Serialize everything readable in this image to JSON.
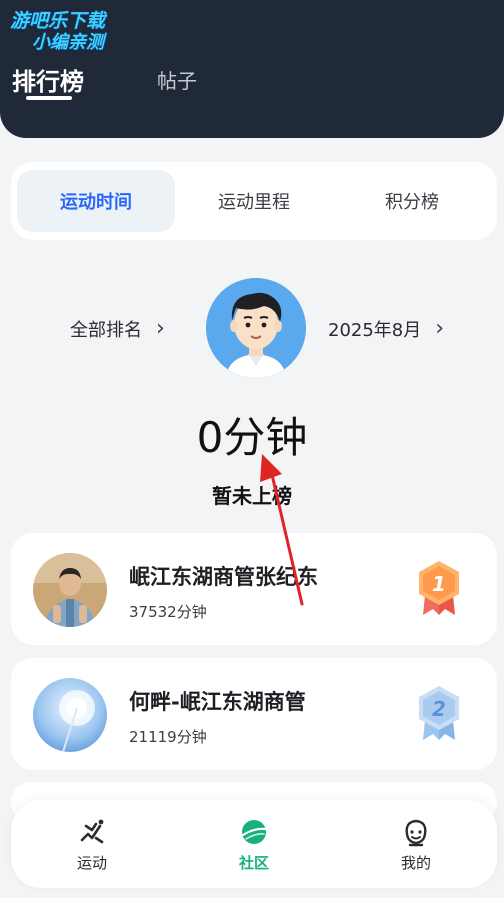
{
  "watermark": {
    "line1": "游吧乐下载",
    "line2": "小编亲测"
  },
  "header": {
    "tabs": [
      {
        "label": "排行榜",
        "active": true
      },
      {
        "label": "帖子",
        "active": false
      }
    ]
  },
  "segments": [
    {
      "label": "运动时间",
      "active": true
    },
    {
      "label": "运动里程",
      "active": false
    },
    {
      "label": "积分榜",
      "active": false
    }
  ],
  "summary": {
    "rank_filter": "全部排名",
    "date_filter": "2025年8月",
    "total": "0分钟",
    "status": "暂未上榜"
  },
  "leaderboard": [
    {
      "name": "岷江东湖商管张纪东",
      "time": "37532分钟",
      "rank": "1"
    },
    {
      "name": "何畔-岷江东湖商管",
      "time": "21119分钟",
      "rank": "2"
    }
  ],
  "bottom_nav": [
    {
      "label": "运动",
      "icon": "running-icon",
      "active": false
    },
    {
      "label": "社区",
      "icon": "planet-icon",
      "active": true
    },
    {
      "label": "我的",
      "icon": "smile-face-icon",
      "active": false
    }
  ],
  "colors": {
    "header_bg": "#1f2937",
    "accent_blue": "#2b67f6",
    "accent_green": "#17b07f",
    "arrow_red": "#e02424"
  }
}
